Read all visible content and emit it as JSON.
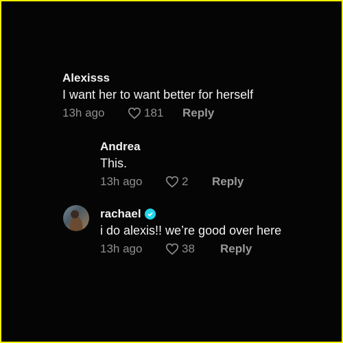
{
  "comments": [
    {
      "author": "Alexisss",
      "text": "I want her to want better for herself",
      "time": "13h ago",
      "likes": "181",
      "reply_label": "Reply",
      "verified": false
    },
    {
      "author": "Andrea",
      "text": "This.",
      "time": "13h ago",
      "likes": "2",
      "reply_label": "Reply",
      "verified": false
    },
    {
      "author": "rachael",
      "text": "i do alexis!! we’re good over here",
      "time": "13h ago",
      "likes": "38",
      "reply_label": "Reply",
      "verified": true
    }
  ],
  "colors": {
    "border": "#f2f200",
    "background": "#050505",
    "verified_badge": "#20d5ec"
  }
}
